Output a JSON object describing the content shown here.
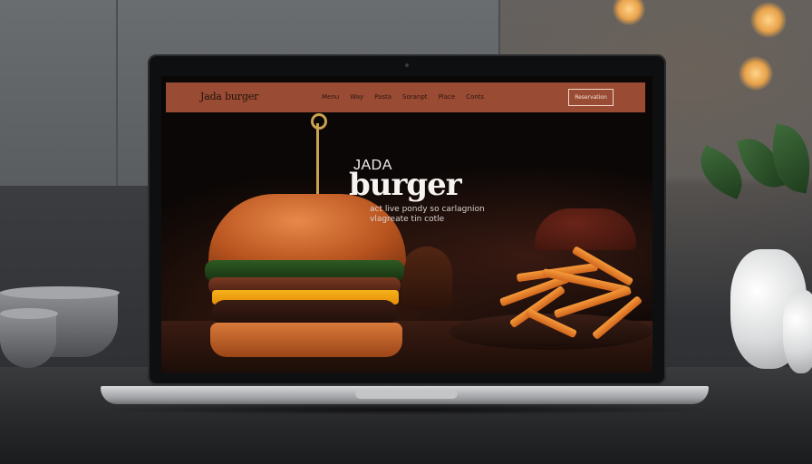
{
  "site": {
    "brand": "Jada burger",
    "nav": {
      "links": [
        "Menu",
        "Way",
        "Pasta",
        "Soranpt",
        "Place",
        "Conts"
      ],
      "cta": "Reservation"
    },
    "hero": {
      "kicker": "JADA",
      "title": "burger",
      "tagline_line1": "act live pondy so carlagnion",
      "tagline_line2": "vlagreate tin cotle"
    }
  },
  "colors": {
    "nav_bar": "#9a4b33",
    "hero_bg": "#0b0706",
    "cheese": "#f6b219",
    "fries": "#f59a3a",
    "toothpick": "#c9a24d"
  },
  "icons": {
    "webcam": "camera-dot-icon"
  }
}
